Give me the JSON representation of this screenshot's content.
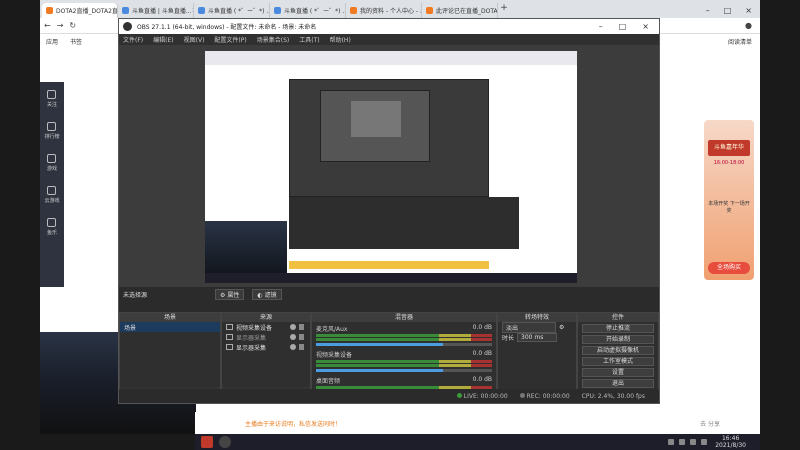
{
  "browser": {
    "tabs": [
      {
        "label": "DOTA2直播_DOTA2直播高清...",
        "color": "#f07b22"
      },
      {
        "label": "斗鱼直播 | 斗鱼直播...",
        "color": "#4a8be0"
      },
      {
        "label": "斗鱼直播 ( *゜ー゜*) ...",
        "color": "#4a8be0"
      },
      {
        "label": "斗鱼直播 ( *゜ー゜*) ...",
        "color": "#4a8be0"
      },
      {
        "label": "我的资料 - 个人中心 - 斗鱼",
        "color": "#f07b22"
      },
      {
        "label": "此评论已在直播_DOTA2...",
        "color": "#f07b22"
      }
    ],
    "bookmarks": {
      "apps": "应用",
      "bookmarks": "书签",
      "reading_mode": "阅读清单"
    }
  },
  "douyu_nav": [
    {
      "label": "关注",
      "icon": "heart-icon"
    },
    {
      "label": "排行榜",
      "icon": "rank-icon"
    },
    {
      "label": "游戏",
      "icon": "gamepad-icon"
    },
    {
      "label": "云游戏",
      "icon": "cloud-game-icon"
    },
    {
      "label": "鱼乐",
      "icon": "trophy-icon"
    }
  ],
  "promo": {
    "title": "斗鱼嘉年华",
    "time": "16:00-18:00",
    "sub": "本场开奖 下一场开奖",
    "button": "全场购买"
  },
  "obs": {
    "title": "OBS 27.1.1 (64-bit, windows) - 配置文件: 未命名 - 场景: 未命名",
    "menu": [
      "文件(F)",
      "编辑(E)",
      "视图(V)",
      "配置文件(P)",
      "场景集合(S)",
      "工具(T)",
      "帮助(H)"
    ],
    "scene_selector": "未选择源",
    "prop_buttons": [
      "属性",
      "滤镜"
    ],
    "dock_headers": {
      "scenes": "场景",
      "sources": "来源",
      "mixer": "混音器",
      "transitions": "转场特效",
      "controls": "控件"
    },
    "scenes": [
      "场景"
    ],
    "sources": [
      "视频采集设备",
      "显示器采集",
      "显示器采集"
    ],
    "mixer": [
      {
        "name": "麦克风/Aux",
        "db": "0.0 dB",
        "level": 0.72
      },
      {
        "name": "视频采集设备",
        "db": "0.0 dB",
        "level": 0.72
      },
      {
        "name": "桌面音频",
        "db": "0.0 dB",
        "level": 0.72
      }
    ],
    "transitions": {
      "type": "淡出",
      "duration_label": "时长",
      "duration": "300 ms"
    },
    "controls": [
      "停止推流",
      "开始录制",
      "启动虚拟摄像机",
      "工作室模式",
      "设置",
      "退出"
    ],
    "status": {
      "live": "LIVE: 00:00:00",
      "rec": "REC: 00:00:00",
      "cpu": "CPU: 2.4%, 30.00 fps"
    }
  },
  "chat_strip": {
    "text1": "主播由于来访说明，私信发送同时！",
    "text2": "去 分享"
  },
  "taskbar": {
    "time": "16:46",
    "date": "2021/8/30"
  },
  "colors": {
    "accent": "#f07b22",
    "obs_bg": "#2b2b2b",
    "selection": "#1d3b5c"
  }
}
